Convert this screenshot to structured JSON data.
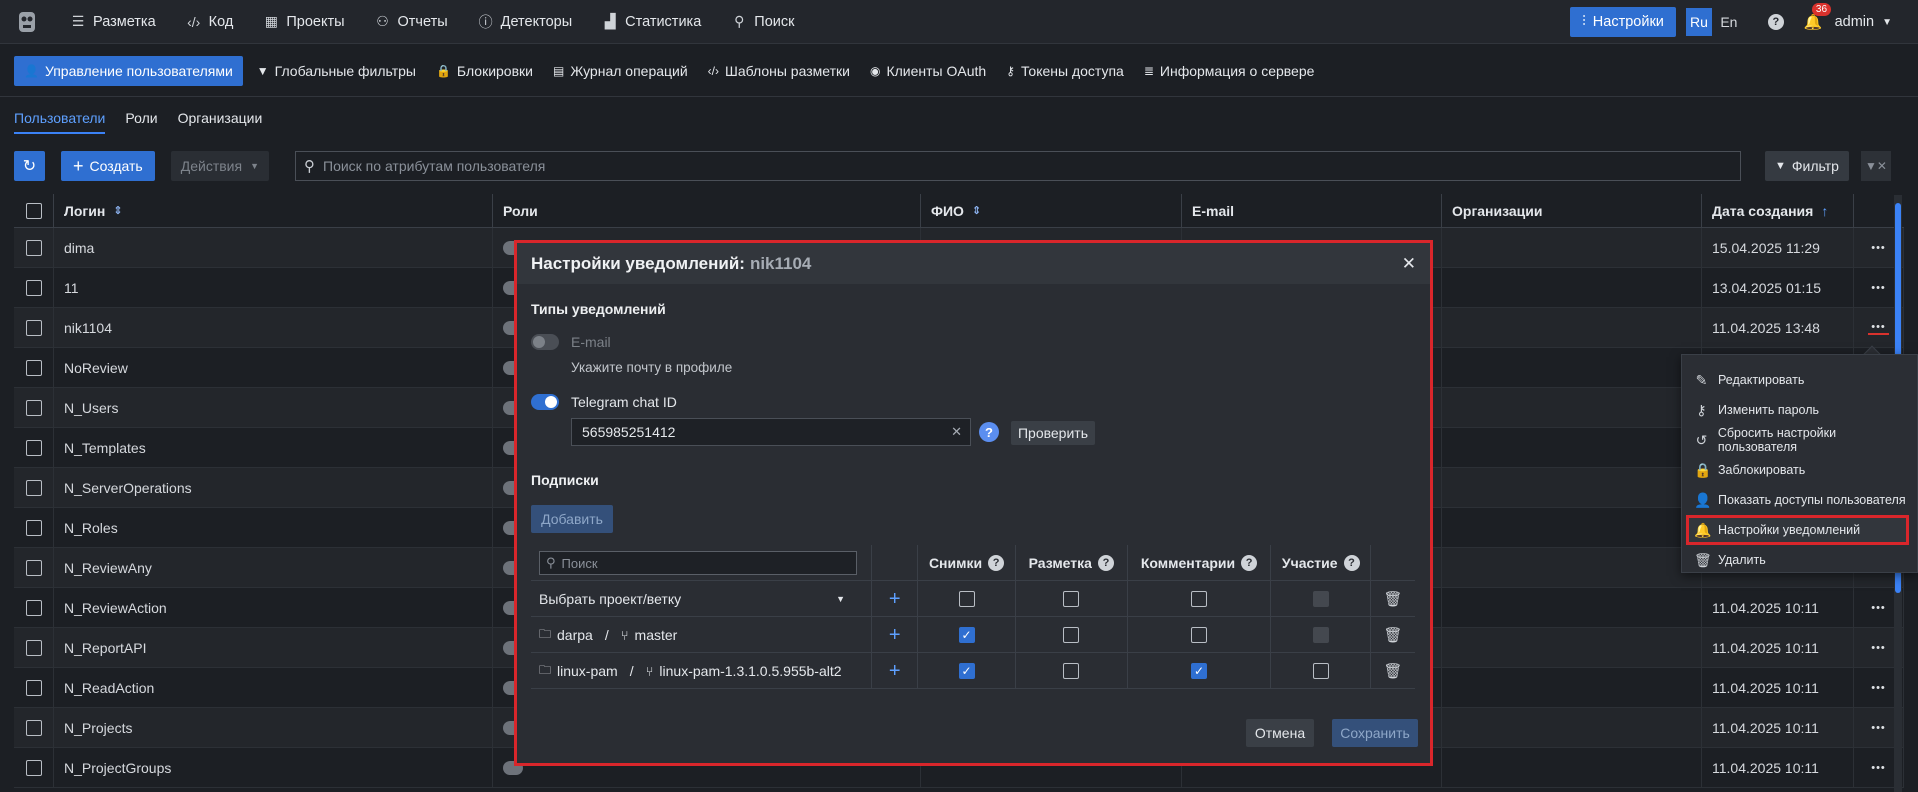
{
  "topnav": {
    "items": [
      {
        "label": "Разметка",
        "icon": "list-icon",
        "glyph": "☰"
      },
      {
        "label": "Код",
        "icon": "code-icon",
        "glyph": "‹/›"
      },
      {
        "label": "Проекты",
        "icon": "projects-icon",
        "glyph": "▦"
      },
      {
        "label": "Отчеты",
        "icon": "reports-icon",
        "glyph": "⚇"
      },
      {
        "label": "Детекторы",
        "icon": "detectors-icon",
        "glyph": "ⓘ"
      },
      {
        "label": "Статистика",
        "icon": "statistics-icon",
        "glyph": "▟"
      },
      {
        "label": "Поиск",
        "icon": "search-icon",
        "glyph": "⚲"
      }
    ],
    "settings_label": "Настройки",
    "lang_ru": "Ru",
    "lang_en": "En",
    "notifications_count": "36",
    "user": "admin"
  },
  "subnav": {
    "items": [
      {
        "label": "Управление пользователями",
        "glyph": "👤"
      },
      {
        "label": "Глобальные фильтры",
        "glyph": "▼"
      },
      {
        "label": "Блокировки",
        "glyph": "🔒"
      },
      {
        "label": "Журнал операций",
        "glyph": "▤"
      },
      {
        "label": "Шаблоны разметки",
        "glyph": "‹/›"
      },
      {
        "label": "Клиенты OAuth",
        "glyph": "◉"
      },
      {
        "label": "Токены доступа",
        "glyph": "⚷"
      },
      {
        "label": "Информация о сервере",
        "glyph": "≣"
      }
    ]
  },
  "tabs": [
    "Пользователи",
    "Роли",
    "Организации"
  ],
  "toolbar": {
    "create_label": "Создать",
    "actions_label": "Действия",
    "search_placeholder": "Поиск по атрибутам пользователя",
    "filter_label": "Фильтр"
  },
  "table": {
    "columns": {
      "login": "Логин",
      "roles": "Роли",
      "fio": "ФИО",
      "email": "E-mail",
      "orgs": "Организации",
      "created": "Дата создания"
    },
    "rows": [
      {
        "login": "dima",
        "date": "15.04.2025 11:29"
      },
      {
        "login": "11",
        "date": "13.04.2025 01:15"
      },
      {
        "login": "nik1104",
        "date": "11.04.2025 13:48"
      },
      {
        "login": "NoReview",
        "date": ""
      },
      {
        "login": "N_Users",
        "date": ""
      },
      {
        "login": "N_Templates",
        "date": ""
      },
      {
        "login": "N_ServerOperations",
        "date": ""
      },
      {
        "login": "N_Roles",
        "date": ""
      },
      {
        "login": "N_ReviewAny",
        "date": ""
      },
      {
        "login": "N_ReviewAction",
        "date": "11.04.2025 10:11"
      },
      {
        "login": "N_ReportAPI",
        "date": "11.04.2025 10:11"
      },
      {
        "login": "N_ReadAction",
        "date": "11.04.2025 10:11"
      },
      {
        "login": "N_Projects",
        "date": "11.04.2025 10:11"
      },
      {
        "login": "N_ProjectGroups",
        "date": "11.04.2025 10:11"
      }
    ]
  },
  "modal": {
    "title": "Настройки уведомлений:",
    "username": "nik1104",
    "types_title": "Типы уведомлений",
    "email_label": "E-mail",
    "email_hint": "Укажите почту в профиле",
    "telegram_label": "Telegram chat ID",
    "telegram_value": "565985251412",
    "check_label": "Проверить",
    "subs_title": "Подписки",
    "add_label": "Добавить",
    "search_placeholder": "Поиск",
    "col_snapshots": "Снимки",
    "col_markup": "Разметка",
    "col_comments": "Комментарии",
    "col_participation": "Участие",
    "select_project": "Выбрать проект/ветку",
    "subs": [
      {
        "project": "darpa",
        "branch": "master",
        "snapshots": true,
        "markup": false,
        "comments": false,
        "participation": "disabled"
      },
      {
        "project": "linux-pam",
        "branch": "linux-pam-1.3.1.0.5.955b-alt2",
        "snapshots": true,
        "markup": false,
        "comments": true,
        "participation": false
      }
    ],
    "cancel_label": "Отмена",
    "save_label": "Сохранить"
  },
  "context_menu": {
    "items": [
      {
        "label": "Редактировать",
        "glyph": "✎",
        "icon": "pencil-icon"
      },
      {
        "label": "Изменить пароль",
        "glyph": "⚷",
        "icon": "key-icon"
      },
      {
        "label": "Сбросить настройки пользователя",
        "glyph": "↺",
        "icon": "reset-icon"
      },
      {
        "label": "Заблокировать",
        "glyph": "🔒",
        "icon": "lock-icon"
      },
      {
        "label": "Показать доступы пользователя",
        "glyph": "👤",
        "icon": "user-icon"
      },
      {
        "label": "Настройки уведомлений",
        "glyph": "🔔",
        "icon": "bell-icon"
      },
      {
        "label": "Удалить",
        "glyph": "🗑",
        "icon": "trash-icon"
      }
    ]
  }
}
